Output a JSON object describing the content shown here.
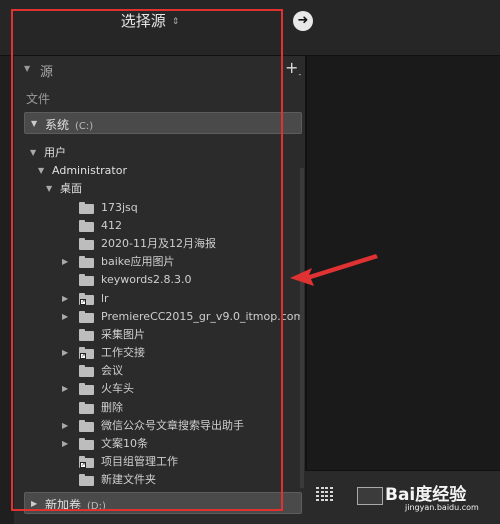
{
  "header": {
    "title": "选择源",
    "caret": "⇕"
  },
  "source_panel": {
    "label": "源",
    "add": "+",
    "add_sub": "-"
  },
  "files_label": "文件",
  "volume_c": {
    "name": "系统",
    "path": "(C:)"
  },
  "volume_d": {
    "name": "新加卷",
    "path": "(D:)"
  },
  "tree": [
    {
      "label": "用户",
      "kind": "header",
      "indent": 0
    },
    {
      "label": "Administrator",
      "kind": "header",
      "indent": 1
    },
    {
      "label": "桌面",
      "kind": "header",
      "indent": 2
    },
    {
      "label": "173jsq",
      "kind": "folder",
      "expandable": false,
      "shortcut": false
    },
    {
      "label": "412",
      "kind": "folder",
      "expandable": false,
      "shortcut": false
    },
    {
      "label": "2020-11月及12月海报",
      "kind": "folder",
      "expandable": false,
      "shortcut": false
    },
    {
      "label": "baike应用图片",
      "kind": "folder",
      "expandable": true,
      "shortcut": false
    },
    {
      "label": "keywords2.8.3.0",
      "kind": "folder",
      "expandable": false,
      "shortcut": false
    },
    {
      "label": "lr",
      "kind": "folder",
      "expandable": true,
      "shortcut": true
    },
    {
      "label": "PremiereCC2015_gr_v9.0_itmop.com",
      "kind": "folder",
      "expandable": true,
      "shortcut": false
    },
    {
      "label": "采集图片",
      "kind": "folder",
      "expandable": false,
      "shortcut": false
    },
    {
      "label": "工作交接",
      "kind": "folder",
      "expandable": true,
      "shortcut": true
    },
    {
      "label": "会议",
      "kind": "folder",
      "expandable": false,
      "shortcut": false
    },
    {
      "label": "火车头",
      "kind": "folder",
      "expandable": true,
      "shortcut": false
    },
    {
      "label": "删除",
      "kind": "folder",
      "expandable": false,
      "shortcut": false
    },
    {
      "label": "微信公众号文章搜索导出助手",
      "kind": "folder",
      "expandable": true,
      "shortcut": false
    },
    {
      "label": "文案10条",
      "kind": "folder",
      "expandable": true,
      "shortcut": false
    },
    {
      "label": "项目组管理工作",
      "kind": "folder",
      "expandable": false,
      "shortcut": true
    },
    {
      "label": "新建文件夹",
      "kind": "folder",
      "expandable": false,
      "shortcut": false
    }
  ],
  "watermark": {
    "brand": "Bai度经验",
    "url": "jingyan.baidu.com"
  },
  "colors": {
    "highlight": "#e03232",
    "panel": "#2b2b2b",
    "background": "#1f1f1f"
  }
}
